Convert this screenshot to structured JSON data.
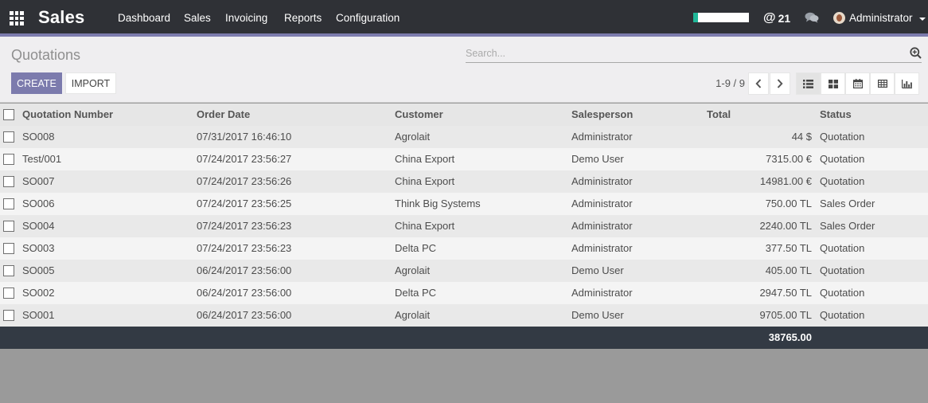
{
  "app": {
    "brand": "Sales"
  },
  "nav": {
    "menus": [
      "Dashboard",
      "Sales",
      "Invoicing",
      "Reports",
      "Configuration"
    ],
    "progress_fraction": 0.08,
    "notification_count": "21",
    "user": "Administrator"
  },
  "control_panel": {
    "title": "Quotations",
    "search_placeholder": "Search...",
    "create_label": "CREATE",
    "import_label": "IMPORT",
    "pager": "1-9 / 9"
  },
  "table": {
    "columns": [
      "Quotation Number",
      "Order Date",
      "Customer",
      "Salesperson",
      "Total",
      "Status"
    ],
    "rows": [
      [
        "SO008",
        "07/31/2017 16:46:10",
        "Agrolait",
        "Administrator",
        "44 $",
        "Quotation"
      ],
      [
        "Test/001",
        "07/24/2017 23:56:27",
        "China Export",
        "Demo User",
        "7315.00 €",
        "Quotation"
      ],
      [
        "SO007",
        "07/24/2017 23:56:26",
        "China Export",
        "Administrator",
        "14981.00 €",
        "Quotation"
      ],
      [
        "SO006",
        "07/24/2017 23:56:25",
        "Think Big Systems",
        "Administrator",
        "750.00 TL",
        "Sales Order"
      ],
      [
        "SO004",
        "07/24/2017 23:56:23",
        "China Export",
        "Administrator",
        "2240.00 TL",
        "Sales Order"
      ],
      [
        "SO003",
        "07/24/2017 23:56:23",
        "Delta PC",
        "Administrator",
        "377.50 TL",
        "Quotation"
      ],
      [
        "SO005",
        "06/24/2017 23:56:00",
        "Agrolait",
        "Demo User",
        "405.00 TL",
        "Quotation"
      ],
      [
        "SO002",
        "06/24/2017 23:56:00",
        "Delta PC",
        "Administrator",
        "2947.50 TL",
        "Quotation"
      ],
      [
        "SO001",
        "06/24/2017 23:56:00",
        "Agrolait",
        "Demo User",
        "9705.00 TL",
        "Quotation"
      ]
    ],
    "footer_total": "38765.00"
  },
  "colors": {
    "accent": "#7c7bad",
    "topbar": "#2f3136",
    "progress": "#21b799"
  },
  "icons": {
    "apps": "apps-grid-icon",
    "notifications": "at-icon",
    "chat": "chat-bubbles-icon",
    "search": "search-plus-icon",
    "views": [
      "list-view-icon",
      "kanban-view-icon",
      "calendar-view-icon",
      "pivot-view-icon",
      "graph-view-icon"
    ]
  }
}
